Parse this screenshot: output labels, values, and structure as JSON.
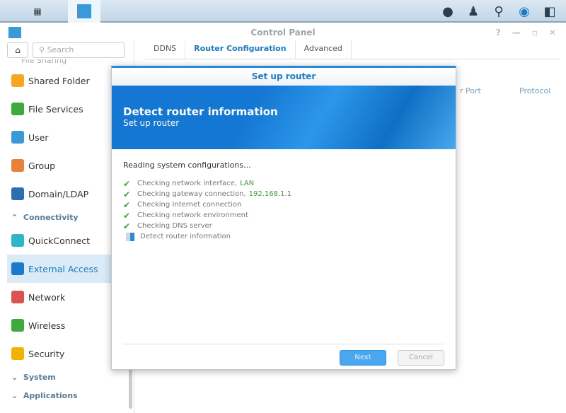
{
  "taskbar": {
    "icons": [
      "main-menu-icon",
      "control-panel-icon"
    ],
    "right_icons": [
      "notification-icon",
      "user-icon",
      "search-icon",
      "widgets-icon",
      "desktop-icon"
    ]
  },
  "window": {
    "title": "Control Panel",
    "controls": [
      "?",
      "—",
      "▫",
      "✕"
    ]
  },
  "sidebar": {
    "search_placeholder": "Search",
    "partial_item": "File Sharing",
    "items": [
      {
        "label": "Shared Folder",
        "color": "#f5a623"
      },
      {
        "label": "File Services",
        "color": "#3caa3c"
      },
      {
        "label": "User",
        "color": "#3a9ad9"
      },
      {
        "label": "Group",
        "color": "#e8823a"
      },
      {
        "label": "Domain/LDAP",
        "color": "#2a6fb0"
      }
    ],
    "section_connectivity": "Connectivity",
    "items2": [
      {
        "label": "QuickConnect",
        "color": "#2eb6c8"
      },
      {
        "label": "External Access",
        "color": "#1b7ac9",
        "active": true
      },
      {
        "label": "Network",
        "color": "#d9534f"
      },
      {
        "label": "Wireless",
        "color": "#3caa3c"
      },
      {
        "label": "Security",
        "color": "#f0b400"
      }
    ],
    "section_system": "System",
    "section_applications": "Applications"
  },
  "tabs": [
    "DDNS",
    "Router Configuration",
    "Advanced"
  ],
  "table": {
    "columns": [
      "r Port",
      "Protocol"
    ]
  },
  "dialog": {
    "title": "Set up router",
    "heading": "Detect router information",
    "subheading": "Set up router",
    "lead": "Reading system configurations...",
    "steps": [
      {
        "text": "Checking network interface,",
        "value": "LAN",
        "done": true
      },
      {
        "text": "Checking gateway connection,",
        "value": "192.168.1.1",
        "done": true
      },
      {
        "text": "Checking Internet connection",
        "done": true
      },
      {
        "text": "Checking network environment",
        "done": true
      },
      {
        "text": "Checking DNS server",
        "done": true
      },
      {
        "text": "Detect router information",
        "done": false
      }
    ],
    "next": "Next",
    "cancel": "Cancel"
  }
}
